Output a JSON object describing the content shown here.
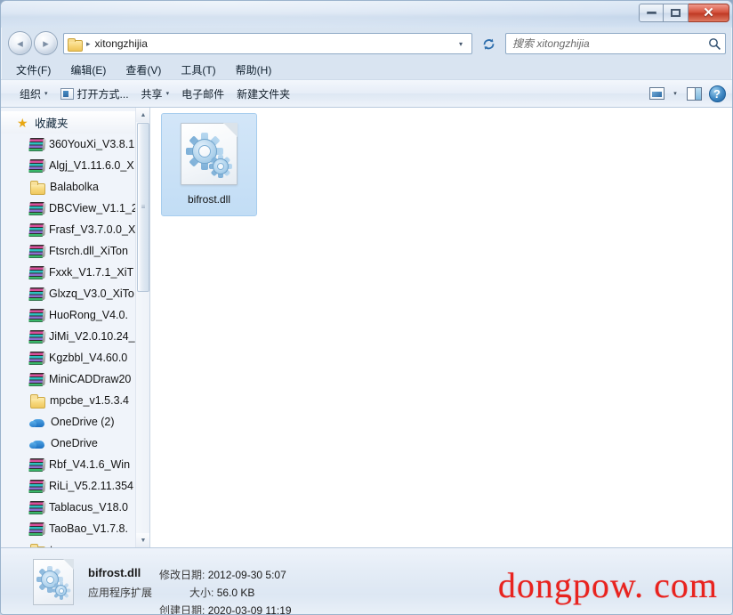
{
  "window": {
    "title": "",
    "controls": {
      "minimize": "–",
      "maximize": "□",
      "close": "✕"
    }
  },
  "navigation": {
    "back_label": "◂",
    "forward_label": "▸",
    "history_caret": "▾",
    "refresh_label": "↻"
  },
  "address": {
    "crumb_separator": "▸",
    "current_folder": "xitongzhijia",
    "dropdown_caret": "▾",
    "folder_icon": "folder-icon"
  },
  "search": {
    "placeholder": "搜索 xitongzhijia",
    "value": "",
    "icon": "search-icon"
  },
  "menubar": {
    "items": [
      {
        "label": "文件(F)",
        "name": "menu-file"
      },
      {
        "label": "编辑(E)",
        "name": "menu-edit"
      },
      {
        "label": "查看(V)",
        "name": "menu-view"
      },
      {
        "label": "工具(T)",
        "name": "menu-tools"
      },
      {
        "label": "帮助(H)",
        "name": "menu-help"
      }
    ]
  },
  "toolbar": {
    "organize_label": "组织",
    "open_with_label": "打开方式...",
    "share_label": "共享",
    "email_label": "电子邮件",
    "new_folder_label": "新建文件夹",
    "caret": "▾",
    "help_glyph": "?"
  },
  "sidebar": {
    "header": {
      "label": "收藏夹",
      "icon": "star-icon"
    },
    "items": [
      {
        "label": "360YouXi_V3.8.1",
        "icon": "archive-icon"
      },
      {
        "label": "Algj_V1.11.6.0_X",
        "icon": "archive-icon"
      },
      {
        "label": "Balabolka",
        "icon": "folder-icon"
      },
      {
        "label": "DBCView_V1.1_2",
        "icon": "archive-icon"
      },
      {
        "label": "Frasf_V3.7.0.0_X",
        "icon": "archive-icon"
      },
      {
        "label": "Ftsrch.dll_XiTon",
        "icon": "archive-icon"
      },
      {
        "label": "Fxxk_V1.7.1_XiT",
        "icon": "archive-icon"
      },
      {
        "label": "Glxzq_V3.0_XiTo",
        "icon": "archive-icon"
      },
      {
        "label": "HuoRong_V4.0.",
        "icon": "archive-icon"
      },
      {
        "label": "JiMi_V2.0.10.24_",
        "icon": "archive-icon"
      },
      {
        "label": "Kgzbbl_V4.60.0",
        "icon": "archive-icon"
      },
      {
        "label": "MiniCADDraw20",
        "icon": "archive-icon"
      },
      {
        "label": "mpcbe_v1.5.3.4",
        "icon": "folder-icon"
      },
      {
        "label": "OneDrive (2)",
        "icon": "cloud-icon"
      },
      {
        "label": "OneDrive",
        "icon": "cloud-icon"
      },
      {
        "label": "Rbf_V4.1.6_Win",
        "icon": "archive-icon"
      },
      {
        "label": "RiLi_V5.2.11.354",
        "icon": "archive-icon"
      },
      {
        "label": "Tablacus_V18.0",
        "icon": "archive-icon"
      },
      {
        "label": "TaoBao_V1.7.8.",
        "icon": "archive-icon"
      },
      {
        "label": "tsq",
        "icon": "folder-icon"
      }
    ],
    "scrollbar": {
      "up_arrow": "▲",
      "down_arrow": "▼",
      "grip": "≡"
    }
  },
  "files": [
    {
      "name": "bifrost.dll",
      "icon": "dll-gear-icon",
      "selected": true
    }
  ],
  "status": {
    "file_name": "bifrost.dll",
    "file_type": "应用程序扩展",
    "modified_label": "修改日期:",
    "modified_value": "2012-09-30 5:07",
    "size_label": "大小:",
    "size_value": "56.0 KB",
    "created_label": "创建日期:",
    "created_value": "2020-03-09 11:19"
  },
  "watermark": {
    "text": "dongpow. com",
    "color": "#e8231f"
  },
  "colors": {
    "accent": "#2f6fad",
    "selection": "#c2ddf5",
    "chrome": "#dde7f3",
    "close_button": "#c0392b"
  }
}
